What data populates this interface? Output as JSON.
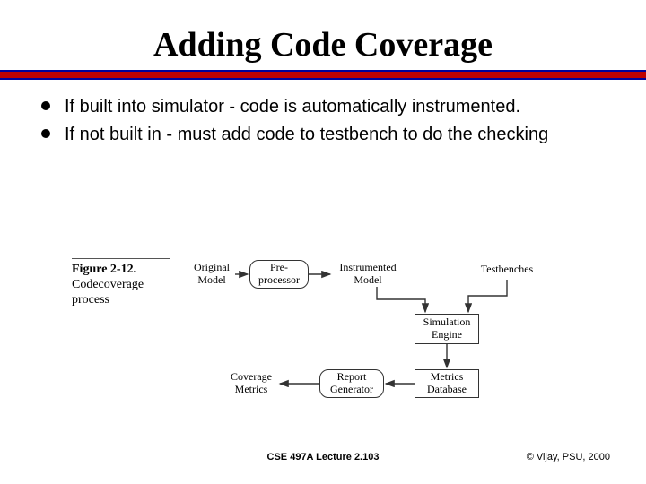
{
  "title": "Adding Code Coverage",
  "bullets": [
    "If built into simulator - code is automatically instrumented.",
    "If not built in - must add code to testbench to do the checking"
  ],
  "figure": {
    "label": "Figure 2-12.",
    "caption": "Codecoverage process",
    "nodes": {
      "original_model": "Original\nModel",
      "preprocessor": "Pre-\nprocessor",
      "instrumented_model": "Instrumented\nModel",
      "testbenches": "Testbenches",
      "simulation_engine": "Simulation\nEngine",
      "metrics_db": "Metrics\nDatabase",
      "report_generator": "Report\nGenerator",
      "coverage_metrics": "Coverage\nMetrics"
    }
  },
  "footer": {
    "center": "CSE 497A Lecture 2.103",
    "right": "© Vijay, PSU, 2000"
  }
}
